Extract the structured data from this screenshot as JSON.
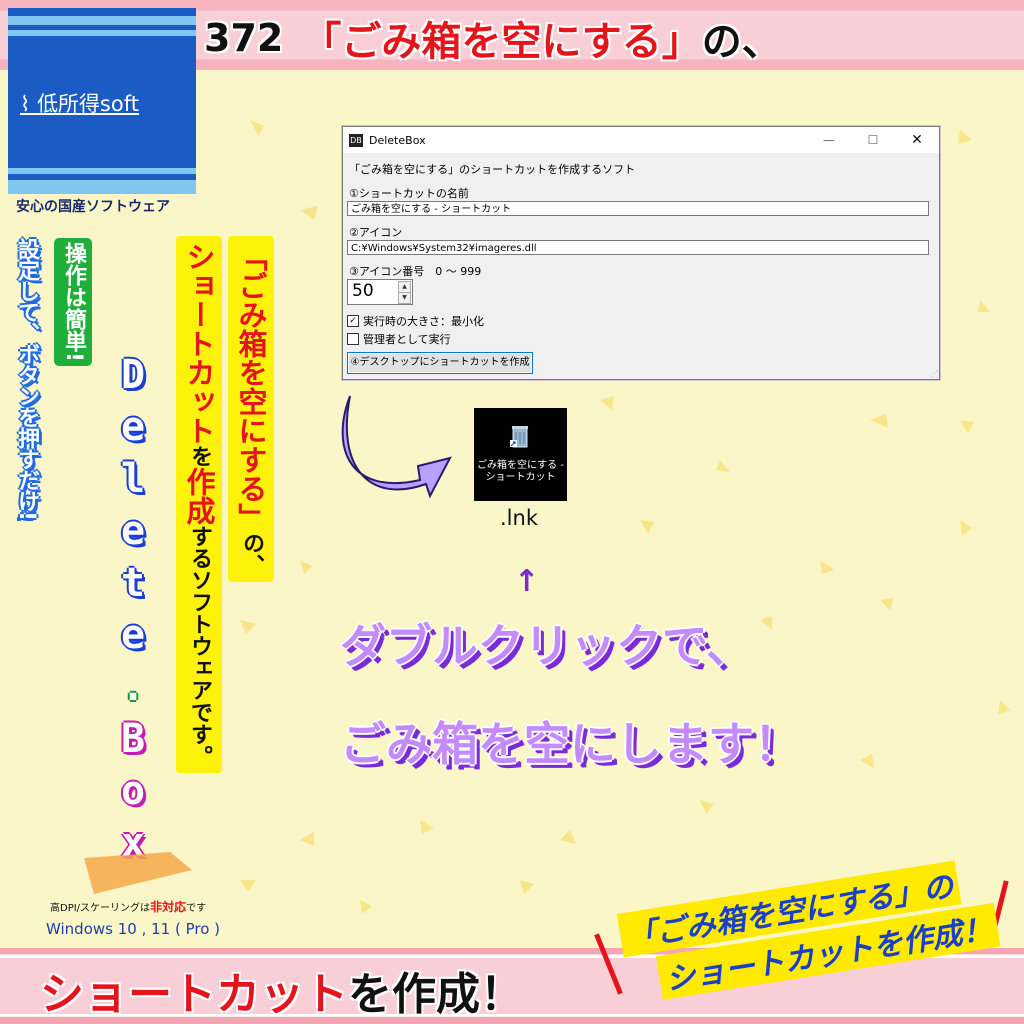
{
  "header": {
    "number": "372",
    "title_highlight": "「ごみ箱を空にする」",
    "title_suffix": "の、"
  },
  "logo": {
    "brand": "低所得soft",
    "tagline": "安心の国産ソフトウェア"
  },
  "vertical_texts": {
    "green": "操作は簡単!",
    "blue": "設定して、ボタンを押すだけ!",
    "yellow1_red": "「ごみ箱を空にする」",
    "yellow1_black": "の、",
    "yellow2_red1": "ショートカット",
    "yellow2_black1": "を",
    "yellow2_red2": "作成",
    "yellow2_black2": "するソフトウェアです。"
  },
  "app_name_letters": [
    "D",
    "e",
    "l",
    "e",
    "t",
    "e",
    ".",
    "B",
    "o",
    "x"
  ],
  "compat": {
    "dpi_prefix": "高DPI/スケーリングは",
    "dpi_red": "非対応",
    "dpi_suffix": "です",
    "windows": "Windows 10 , 11 ( Pro )"
  },
  "window": {
    "title": "DeleteBox",
    "app_icon": "DB",
    "description": "「ごみ箱を空にする」のショートカットを作成するソフト",
    "label_name": "①ショートカットの名前",
    "value_name": "ごみ箱を空にする - ショートカット",
    "label_icon": "②アイコン",
    "value_icon": "C:¥Windows¥System32¥imageres.dll",
    "label_icon_index": "③アイコン番号　0 ～ 999",
    "icon_index": "50",
    "check_minimize_label": "実行時の大きさ：最小化",
    "check_minimize_checked": true,
    "check_admin_label": "管理者として実行",
    "check_admin_checked": false,
    "create_button": "④デスクトップにショートカットを作成"
  },
  "shortcut": {
    "icon_label_line1": "ごみ箱を空にする -",
    "icon_label_line2": "ショートカット",
    "extension": ".lnk"
  },
  "callouts": {
    "arrow_up": "↑",
    "line1": "ダブルクリックで、",
    "line2": "ごみ箱を空にします！"
  },
  "footer": {
    "red": "ショートカット",
    "black": "を作成！"
  },
  "stamp": {
    "line1": "「ごみ箱を空にする」の",
    "line2": "ショートカットを作成！"
  },
  "colors": {
    "accent_red": "#e4141a",
    "logo_blue": "#1a5bc4",
    "purple": "#7a2ad8",
    "stamp_yellow": "#ffea00"
  }
}
